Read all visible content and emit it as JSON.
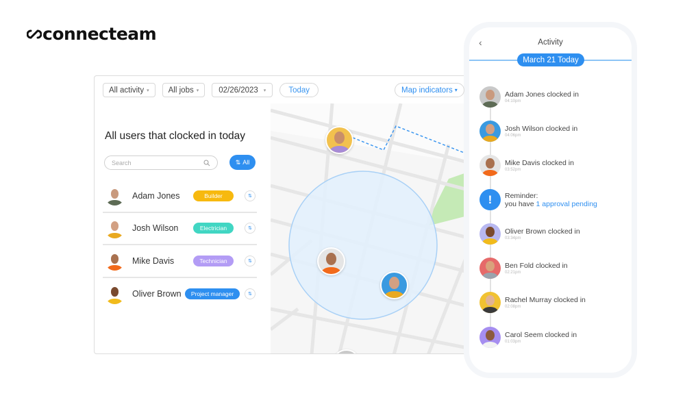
{
  "brand": {
    "name": "connecteam"
  },
  "toolbar": {
    "filters": [
      {
        "label": "All activity"
      },
      {
        "label": "All jobs"
      },
      {
        "label": "02/26/2023"
      }
    ],
    "today_label": "Today",
    "map_indicators_label": "Map indicators",
    "caret": "▾"
  },
  "users_panel": {
    "title": "All users that clocked in today",
    "search_placeholder": "Search",
    "search_icon": "search-icon",
    "all_button_label": "All",
    "all_button_icon": "⇅",
    "swap_icon": "⇅",
    "users": [
      {
        "name": "Adam Jones",
        "role": "Builder",
        "role_color": "#f7b90f",
        "avatar_bg": "#c9c9c9",
        "shirt": "#5d6b55",
        "skin": "#c99a7e"
      },
      {
        "name": "Josh Wilson",
        "role": "Electrician",
        "role_color": "#41d6c3",
        "avatar_bg": "#3a9ae0",
        "shirt": "#e9a920",
        "skin": "#d2a083"
      },
      {
        "name": "Mike Davis",
        "role": "Technician",
        "role_color": "#b39cf5",
        "avatar_bg": "#e5e5e5",
        "shirt": "#f26a1b",
        "skin": "#a9714f"
      },
      {
        "name": "Oliver Brown",
        "role": "Project manager",
        "role_color": "#2e8ff0",
        "avatar_bg": "#b8b8f0",
        "shirt": "#f1bb1c",
        "skin": "#7a4a2e"
      }
    ]
  },
  "map": {
    "pins": [
      {
        "person": "Ben",
        "bg": "#f2c14e",
        "shirt": "#a78bd6",
        "skin": "#c98e6a"
      },
      {
        "person": "Mike Davis",
        "bg": "#e5e5e5",
        "shirt": "#f26a1b",
        "skin": "#a9714f"
      },
      {
        "person": "Josh Wilson",
        "bg": "#3a9ae0",
        "shirt": "#e9a920",
        "skin": "#d2a083"
      },
      {
        "person": "Adam Jones",
        "bg": "#c9c9c9",
        "shirt": "#5d6b55",
        "skin": "#c99a7e"
      }
    ]
  },
  "phone": {
    "back_icon": "‹",
    "title": "Activity",
    "date_label": "March 21 Today",
    "activities": [
      {
        "type": "clock",
        "text": "Adam Jones clocked in",
        "time": "04:10pm",
        "bg": "#c9c9c9",
        "shirt": "#5d6b55",
        "skin": "#c99a7e"
      },
      {
        "type": "clock",
        "text": "Josh Wilson clocked in",
        "time": "04:06pm",
        "bg": "#3a9ae0",
        "shirt": "#e9a920",
        "skin": "#d2a083"
      },
      {
        "type": "clock",
        "text": "Mike Davis clocked in",
        "time": "03:52pm",
        "bg": "#e5e5e5",
        "shirt": "#f26a1b",
        "skin": "#a9714f"
      },
      {
        "type": "reminder",
        "title": "Reminder:",
        "prefix": "you have ",
        "link": "1 approval pending",
        "icon": "!"
      },
      {
        "type": "clock",
        "text": "Oliver Brown clocked in",
        "time": "03:34pm",
        "bg": "#b8b8f0",
        "shirt": "#f1bb1c",
        "skin": "#7a4a2e"
      },
      {
        "type": "clock",
        "text": "Ben Fold clocked in",
        "time": "02:21pm",
        "bg": "#e66a6a",
        "shirt": "#9aa3ad",
        "skin": "#d9a27c"
      },
      {
        "type": "clock",
        "text": "Rachel Murray clocked in",
        "time": "02:08pm",
        "bg": "#f1c232",
        "shirt": "#3a3a3a",
        "skin": "#e2b394"
      },
      {
        "type": "clock",
        "text": "Carol Seem clocked in",
        "time": "01:03pm",
        "bg": "#a68ef0",
        "shirt": "#f2f2f2",
        "skin": "#8c5a3c"
      }
    ]
  }
}
